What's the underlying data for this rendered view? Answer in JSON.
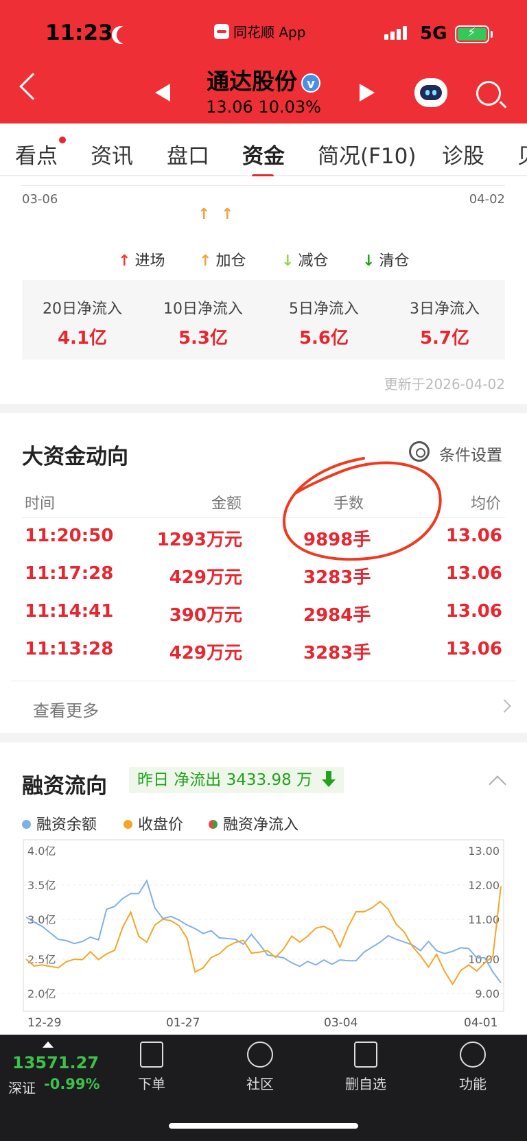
{
  "status": {
    "time": "11:23",
    "app": "同花顺 App",
    "network": "5G"
  },
  "header": {
    "stock_name": "通达股份",
    "verified": "v",
    "price": "13.06",
    "change_pct": "10.03%"
  },
  "tabs": [
    "看点",
    "资讯",
    "盘口",
    "资金",
    "简况(F10)",
    "诊股",
    "贝"
  ],
  "active_tab": "资金",
  "fund_chart": {
    "date_start": "03-06",
    "date_end": "04-02",
    "legend": [
      {
        "label": "进场",
        "color": "#ee3a3a"
      },
      {
        "label": "加仓",
        "color": "#f5a23a"
      },
      {
        "label": "减仓",
        "color": "#9bd24a"
      },
      {
        "label": "清仓",
        "color": "#23a11f"
      }
    ],
    "flows": [
      {
        "label": "20日净流入",
        "value": "4.1亿"
      },
      {
        "label": "10日净流入",
        "value": "5.3亿"
      },
      {
        "label": "5日净流入",
        "value": "5.6亿"
      },
      {
        "label": "3日净流入",
        "value": "5.7亿"
      }
    ],
    "updated": "更新于2026-04-02"
  },
  "big_money": {
    "title": "大资金动向",
    "settings": "条件设置",
    "columns": [
      "时间",
      "金额",
      "手数",
      "均价"
    ],
    "rows": [
      [
        "11:20:50",
        "1293万元",
        "9898手",
        "13.06"
      ],
      [
        "11:17:28",
        "429万元",
        "3283手",
        "13.06"
      ],
      [
        "11:14:41",
        "390万元",
        "2984手",
        "13.06"
      ],
      [
        "11:13:28",
        "429万元",
        "3283手",
        "13.06"
      ]
    ],
    "more": "查看更多"
  },
  "margin": {
    "title": "融资流向",
    "badge": "昨日 净流出 3433.98 万",
    "legend": [
      {
        "label": "融资余额",
        "color": "#7fb0ea"
      },
      {
        "label": "收盘价",
        "color": "#f5a623"
      },
      {
        "label": "融资净流入",
        "color": "#e84a3f"
      }
    ],
    "left_ticks": [
      "4.0亿",
      "3.5亿",
      "3.0亿",
      "2.5亿",
      "2.0亿"
    ],
    "right_ticks": [
      "13.00",
      "12.00",
      "11.00",
      "10.00",
      "9.00"
    ],
    "x_ticks": [
      "12-29",
      "01-27",
      "03-04",
      "04-01"
    ]
  },
  "chart_data": {
    "type": "line",
    "title": "融资流向",
    "x_ticks": [
      "12-29",
      "01-27",
      "03-04",
      "04-01"
    ],
    "ylim_left": [
      2.0,
      4.0
    ],
    "ylim_right": [
      9.0,
      13.0
    ],
    "grid": true,
    "legend_position": "top",
    "series": [
      {
        "name": "融资余额",
        "axis": "left",
        "color": "#7fb0ea",
        "values": [
          3.07,
          3.0,
          2.94,
          2.85,
          2.76,
          2.74,
          2.7,
          2.73,
          2.79,
          2.75,
          3.18,
          3.22,
          3.33,
          3.4,
          3.4,
          3.58,
          3.2,
          3.05,
          3.08,
          3.03,
          2.96,
          2.91,
          2.84,
          2.88,
          2.78,
          2.77,
          2.76,
          2.69,
          2.83,
          2.69,
          2.54,
          2.52,
          2.5,
          2.43,
          2.38,
          2.45,
          2.4,
          2.47,
          2.41,
          2.47,
          2.46,
          2.46,
          2.58,
          2.65,
          2.72,
          2.81,
          2.76,
          2.72,
          2.68,
          2.6,
          2.73,
          2.6,
          2.56,
          2.59,
          2.64,
          2.63,
          2.5,
          2.5,
          2.3,
          2.15
        ]
      },
      {
        "name": "收盘价",
        "axis": "right",
        "color": "#f5a623",
        "values": [
          9.96,
          9.77,
          9.8,
          9.76,
          9.72,
          9.89,
          9.96,
          9.95,
          10.17,
          9.95,
          10.11,
          10.21,
          10.85,
          11.28,
          10.6,
          10.44,
          10.92,
          11.08,
          11.04,
          10.9,
          10.55,
          9.6,
          9.72,
          10.01,
          10.11,
          10.32,
          10.43,
          10.49,
          10.13,
          10.16,
          10.2,
          10.01,
          10.25,
          10.61,
          10.44,
          10.61,
          10.83,
          10.88,
          10.76,
          10.3,
          10.86,
          11.29,
          11.29,
          11.4,
          11.58,
          11.36,
          10.94,
          10.72,
          10.32,
          10.06,
          9.74,
          10.1,
          9.62,
          9.26,
          9.64,
          9.8,
          9.63,
          9.86,
          10.04,
          12.0
        ]
      }
    ]
  }
}
